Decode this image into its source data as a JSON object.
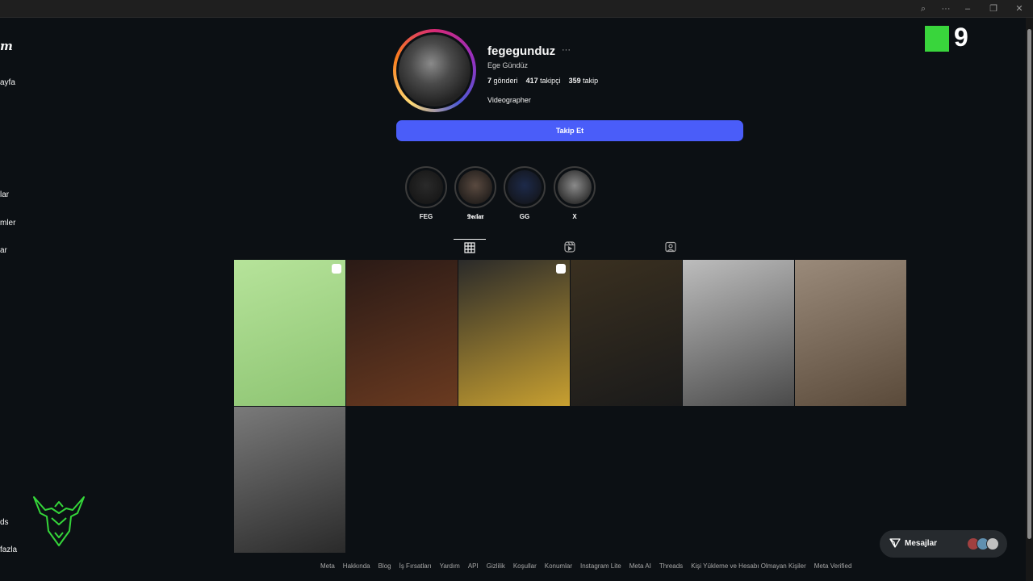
{
  "titlebar": {
    "icons": [
      "zoom-icon",
      "more-icon",
      "minimize-icon",
      "restore-icon",
      "close-icon"
    ],
    "more_glyph": "···",
    "min_glyph": "–",
    "restore_glyph": "❐",
    "close_glyph": "✕",
    "zoom_glyph": "⌕"
  },
  "sidebar": {
    "logo_fragment": "m",
    "items": [
      "ayfa",
      "lar",
      "mler",
      "ar",
      "ds",
      "fazla"
    ]
  },
  "overlay": {
    "k9_number": "9"
  },
  "profile": {
    "username": "fegegunduz",
    "more_glyph": "···",
    "full_name": "Ege Gündüz",
    "posts_count": "7",
    "posts_label": "gönderi",
    "followers_count": "417",
    "followers_label": "takipçi",
    "following_count": "359",
    "following_label": "takip",
    "bio": "Videographer",
    "follow_button": "Takip Et"
  },
  "highlights": [
    {
      "label": "FEG",
      "color": "#2a2a2a"
    },
    {
      "label": "𝕯𝖊𝖈𝖑𝖆𝖗",
      "color": "#5a4a40"
    },
    {
      "label": "GG",
      "color": "#1d2a4a"
    },
    {
      "label": "X",
      "color": "#8a8a8a"
    }
  ],
  "tabs": [
    "posts-grid-tab",
    "reels-tab",
    "tagged-tab"
  ],
  "posts": [
    {
      "colors": [
        "#b6e39a",
        "#8dc472"
      ],
      "badge": true
    },
    {
      "colors": [
        "#2a1a16",
        "#6a3a20"
      ],
      "badge": false
    },
    {
      "colors": [
        "#2a2a2a",
        "#c8a030"
      ],
      "badge": true
    },
    {
      "colors": [
        "#3a3020",
        "#1a1a1a"
      ],
      "badge": false
    },
    {
      "colors": [
        "#bdbdbd",
        "#4a4a4a"
      ],
      "badge": false
    },
    {
      "colors": [
        "#9a8a7a",
        "#5a4a3a"
      ],
      "badge": false
    },
    {
      "colors": [
        "#7a7a7a",
        "#2a2a2a"
      ],
      "badge": false
    }
  ],
  "messages": {
    "label": "Mesajlar",
    "avatar_colors": [
      "#a04040",
      "#6090b0",
      "#c0c0c0"
    ]
  },
  "footer": [
    "Meta",
    "Hakkında",
    "Blog",
    "İş Fırsatları",
    "Yardım",
    "API",
    "Gizlilik",
    "Koşullar",
    "Konumlar",
    "Instagram Lite",
    "Meta AI",
    "Threads",
    "Kişi Yükleme ve Hesabı Olmayan Kişiler",
    "Meta Verified"
  ]
}
